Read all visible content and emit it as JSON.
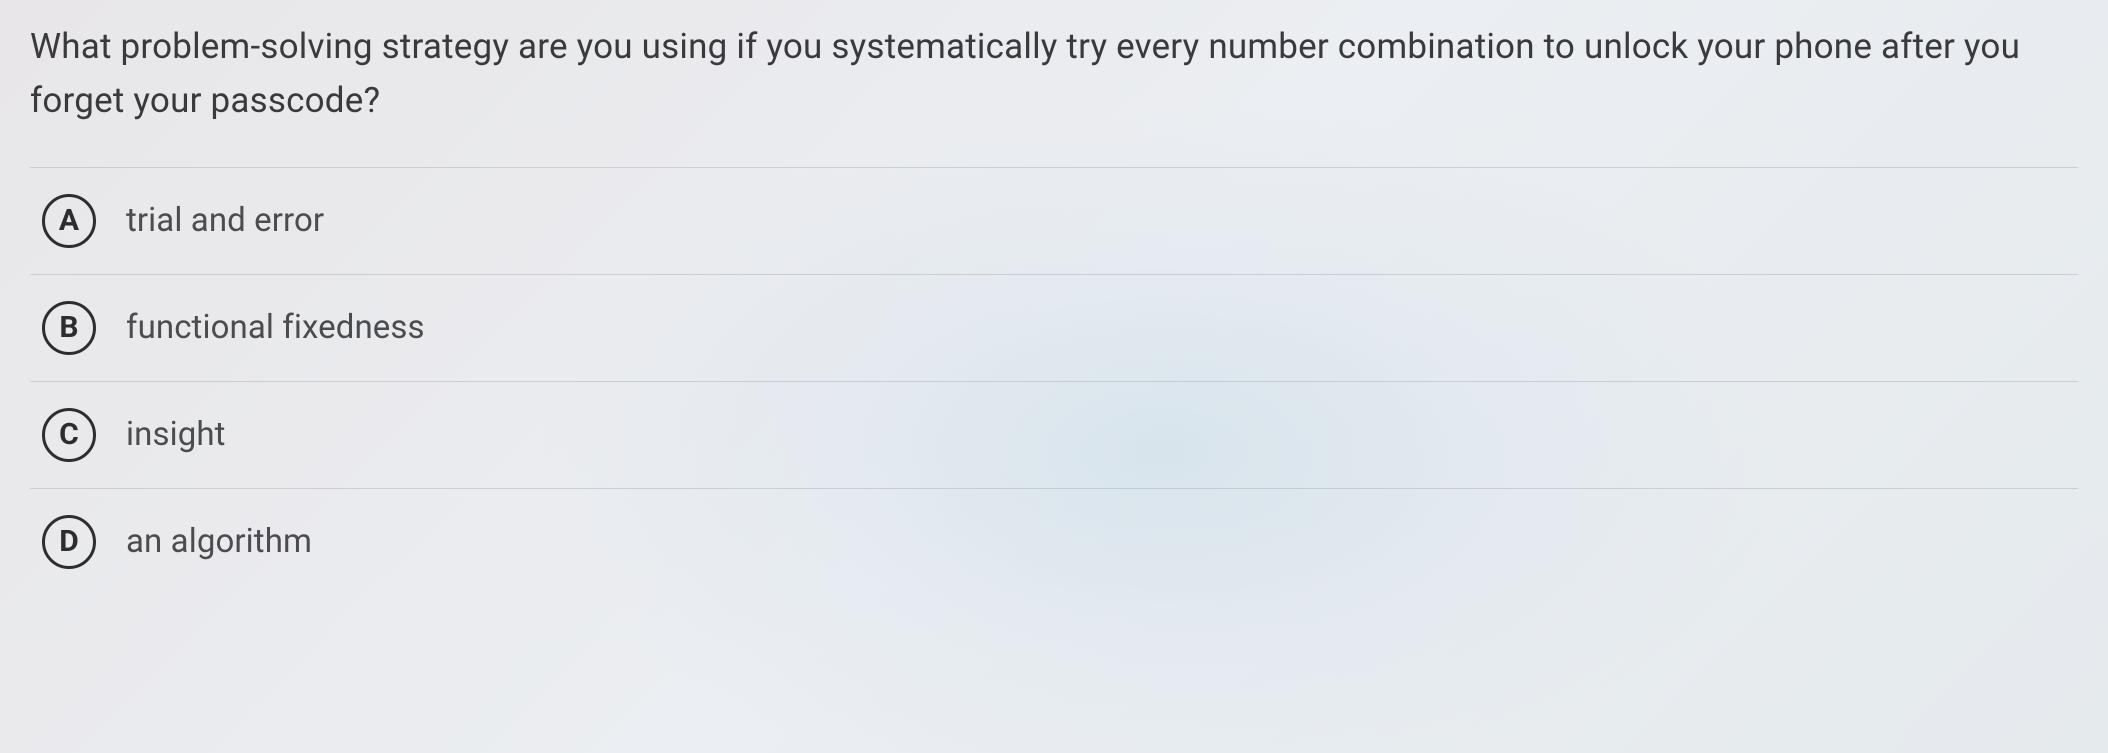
{
  "question": {
    "text": "What problem-solving strategy are you using if you systematically try every number combination to unlock your phone after you forget your passcode?"
  },
  "options": [
    {
      "letter": "A",
      "text": "trial and error"
    },
    {
      "letter": "B",
      "text": "functional fixedness"
    },
    {
      "letter": "C",
      "text": "insight"
    },
    {
      "letter": "D",
      "text": "an algorithm"
    }
  ]
}
